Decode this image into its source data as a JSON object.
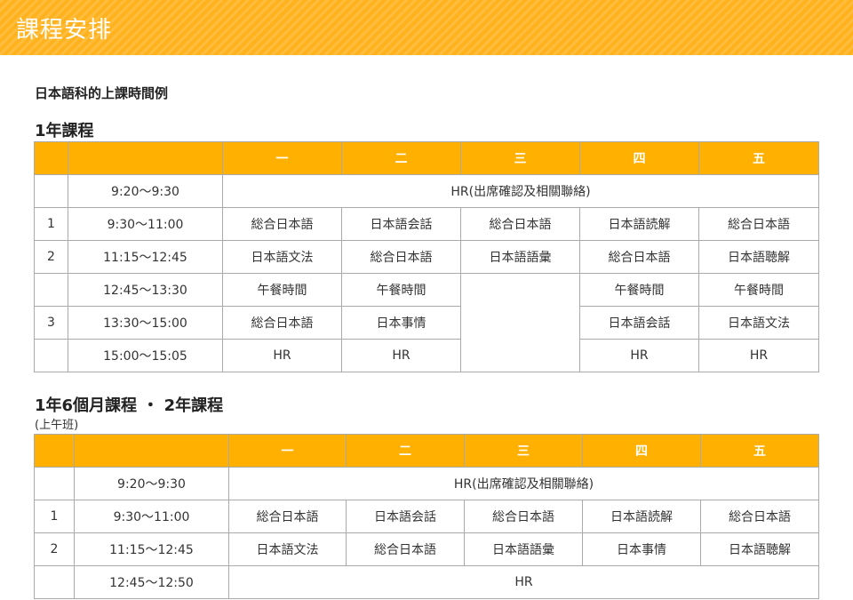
{
  "banner": {
    "title": "課程安排"
  },
  "intro": "日本語科的上課時間例",
  "days": [
    "一",
    "二",
    "三",
    "四",
    "五"
  ],
  "sections": [
    {
      "title": "1年課程",
      "rows": [
        {
          "period": "",
          "time": "9:20～9:30",
          "span": "HR(出席確認及相關聯絡)"
        },
        {
          "period": "1",
          "time": "9:30～11:00",
          "cells": [
            "総合日本語",
            "日本語会話",
            "総合日本語",
            "日本語読解",
            "総合日本語"
          ]
        },
        {
          "period": "2",
          "time": "11:15～12:45",
          "cells": [
            "日本語文法",
            "総合日本語",
            "日本語語彙",
            "総合日本語",
            "日本語聴解"
          ]
        },
        {
          "period": "",
          "time": "12:45～13:30",
          "cells": [
            "午餐時間",
            "午餐時間",
            "",
            "午餐時間",
            "午餐時間"
          ]
        },
        {
          "period": "3",
          "time": "13:30～15:00",
          "cells": [
            "総合日本語",
            "日本事情",
            "日本語会話",
            "日本語文法"
          ]
        },
        {
          "period": "",
          "time": "15:00～15:05",
          "cells": [
            "HR",
            "HR",
            "HR",
            "HR"
          ]
        }
      ]
    },
    {
      "title": "1年6個月課程 ・ 2年課程",
      "subtitle": "(上午班)",
      "rows": [
        {
          "period": "",
          "time": "9:20～9:30",
          "span": "HR(出席確認及相關聯絡)"
        },
        {
          "period": "1",
          "time": "9:30～11:00",
          "cells": [
            "総合日本語",
            "日本語会話",
            "総合日本語",
            "日本語読解",
            "総合日本語"
          ]
        },
        {
          "period": "2",
          "time": "11:15～12:45",
          "cells": [
            "日本語文法",
            "総合日本語",
            "日本語語彙",
            "日本事情",
            "日本語聴解"
          ]
        },
        {
          "period": "",
          "time": "12:45～12:50",
          "span": "HR"
        }
      ]
    }
  ]
}
